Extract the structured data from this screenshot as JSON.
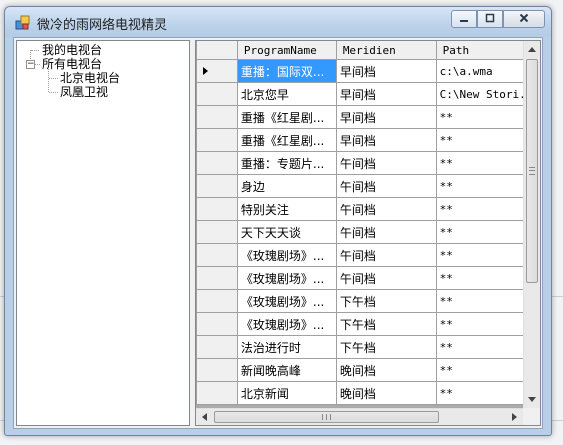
{
  "window": {
    "title": "微冷的雨网络电视精灵",
    "icon": "app-window-icon"
  },
  "caption_buttons": {
    "minimize": "minimize-icon",
    "maximize": "maximize-icon",
    "close": "close-icon"
  },
  "tree": {
    "my_tv": "我的电视台",
    "all_tv": "所有电视台",
    "expander_symbol": "−",
    "children": [
      "北京电视台",
      "凤凰卫视"
    ]
  },
  "grid": {
    "headers": [
      "ProgramName",
      "Meridien",
      "Path"
    ],
    "current_row": 0,
    "rows": [
      [
        "重播：国际双...",
        "早间档",
        "c:\\a.wma"
      ],
      [
        "北京您早",
        "早间档",
        "C:\\New Stori..."
      ],
      [
        "重播《红星剧...",
        "早间档",
        "**"
      ],
      [
        "重播《红星剧...",
        "早间档",
        "**"
      ],
      [
        "重播：专题片...",
        "午间档",
        "**"
      ],
      [
        "身边",
        "午间档",
        "**"
      ],
      [
        "特别关注",
        "午间档",
        "**"
      ],
      [
        "天下天天谈",
        "午间档",
        "**"
      ],
      [
        "《玫瑰剧场》...",
        "午间档",
        "**"
      ],
      [
        "《玫瑰剧场》...",
        "午间档",
        "**"
      ],
      [
        "《玫瑰剧场》...",
        "下午档",
        "**"
      ],
      [
        "《玫瑰剧场》...",
        "下午档",
        "**"
      ],
      [
        "法治进行时",
        "下午档",
        "**"
      ],
      [
        "新闻晚高峰",
        "晚间档",
        "**"
      ],
      [
        "北京新闻",
        "晚间档",
        "**"
      ]
    ]
  },
  "colors": {
    "selection": "#3399ff",
    "titlebar": "#bcd2ea"
  }
}
